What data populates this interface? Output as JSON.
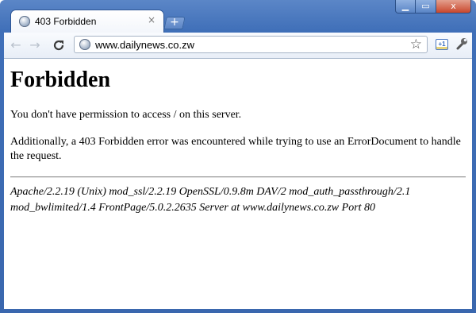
{
  "tab": {
    "title": "403 Forbidden",
    "close_glyph": "×",
    "favicon": "globe-icon"
  },
  "new_tab": {
    "glyph": "+"
  },
  "window_controls": {
    "minimize": "▁",
    "maximize": "▭",
    "close": "x"
  },
  "toolbar": {
    "back_glyph": "←",
    "forward_glyph": "→",
    "reload_glyph": "C",
    "url": "www.dailynews.co.zw",
    "star_glyph": "☆",
    "plus_one_label": "+1",
    "wrench_glyph": "🔧"
  },
  "page": {
    "heading": "Forbidden",
    "paragraph1": "You don't have permission to access / on this server.",
    "paragraph2": "Additionally, a 403 Forbidden error was encountered while trying to use an ErrorDocument to handle the request.",
    "address_line1": "Apache/2.2.19 (Unix) mod_ssl/2.2.19 OpenSSL/0.9.8m DAV/2 mod_auth_passthrough/2.1",
    "address_line2": "mod_bwlimited/1.4 FrontPage/5.0.2.2635 Server at www.dailynews.co.zw Port 80"
  },
  "colors": {
    "frame": "#3f6fb8",
    "page_background": "#ffffff"
  }
}
